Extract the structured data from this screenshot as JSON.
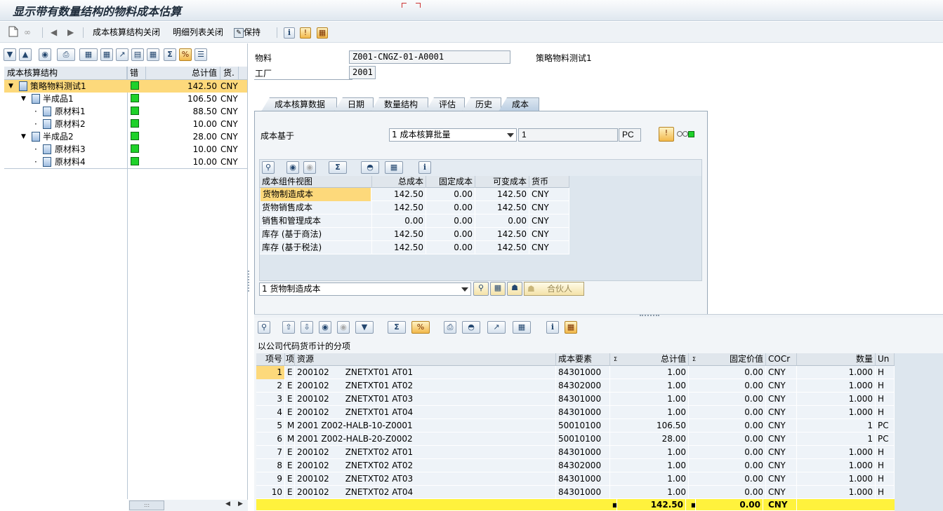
{
  "window": {
    "title": "显示带有数量结构的物料成本估算"
  },
  "toolbar": {
    "cost_structure_close": "成本核算结构关闭",
    "detail_list_close": "明细列表关闭",
    "keep": "保持"
  },
  "tree": {
    "headers": {
      "structure": "成本核算结构",
      "error": "错",
      "total": "总计值",
      "currency": "货."
    },
    "rows": [
      {
        "label": "策略物料测试1",
        "value": "142.50",
        "currency": "CNY"
      },
      {
        "label": "半成品1",
        "value": "106.50",
        "currency": "CNY"
      },
      {
        "label": "原材料1",
        "value": "88.50",
        "currency": "CNY"
      },
      {
        "label": "原材料2",
        "value": "10.00",
        "currency": "CNY"
      },
      {
        "label": "半成品2",
        "value": "28.00",
        "currency": "CNY"
      },
      {
        "label": "原材料3",
        "value": "10.00",
        "currency": "CNY"
      },
      {
        "label": "原材料4",
        "value": "10.00",
        "currency": "CNY"
      }
    ]
  },
  "header": {
    "material_label": "物料",
    "material_value": "Z001-CNGZ-01-A0001",
    "material_desc": "策略物料测试1",
    "plant_label": "工厂",
    "plant_value": "2001"
  },
  "tabs": [
    "成本核算数据",
    "日期",
    "数量结构",
    "评估",
    "历史",
    "成本"
  ],
  "cost": {
    "basis_label": "成本基于",
    "basis_value": "1 成本核算批量",
    "qty": "1",
    "unit": "PC",
    "view_headers": [
      "成本组件视图",
      "总成本",
      "固定成本",
      "可变成本",
      "货币"
    ],
    "view_rows": [
      [
        "货物制造成本",
        "142.50",
        "0.00",
        "142.50",
        "CNY"
      ],
      [
        "货物销售成本",
        "142.50",
        "0.00",
        "142.50",
        "CNY"
      ],
      [
        "销售和管理成本",
        "0.00",
        "0.00",
        "0.00",
        "CNY"
      ],
      [
        "库存 (基于商法)",
        "142.50",
        "0.00",
        "142.50",
        "CNY"
      ],
      [
        "库存 (基于税法)",
        "142.50",
        "0.00",
        "142.50",
        "CNY"
      ]
    ],
    "component_select": "1 货物制造成本",
    "partner_button": "合伙人"
  },
  "itemization": {
    "title": "以公司代码货币计的分项",
    "headers": [
      "项号",
      "项",
      "资源",
      "成本要素",
      "总计值",
      "固定价值",
      "COCr",
      "数量",
      "Un"
    ],
    "rows": [
      [
        "1",
        "E",
        "200102      ZNETXT01 AT01",
        "84301000",
        "1.00",
        "0.00",
        "CNY",
        "1.000",
        "H"
      ],
      [
        "2",
        "E",
        "200102      ZNETXT01 AT02",
        "84302000",
        "1.00",
        "0.00",
        "CNY",
        "1.000",
        "H"
      ],
      [
        "3",
        "E",
        "200102      ZNETXT01 AT03",
        "84301000",
        "1.00",
        "0.00",
        "CNY",
        "1.000",
        "H"
      ],
      [
        "4",
        "E",
        "200102      ZNETXT01 AT04",
        "84301000",
        "1.00",
        "0.00",
        "CNY",
        "1.000",
        "H"
      ],
      [
        "5",
        "M",
        "2001 Z002-HALB-10-Z0001",
        "50010100",
        "106.50",
        "0.00",
        "CNY",
        "1",
        "PC"
      ],
      [
        "6",
        "M",
        "2001 Z002-HALB-20-Z0002",
        "50010100",
        "28.00",
        "0.00",
        "CNY",
        "1",
        "PC"
      ],
      [
        "7",
        "E",
        "200102      ZNETXT02 AT01",
        "84301000",
        "1.00",
        "0.00",
        "CNY",
        "1.000",
        "H"
      ],
      [
        "8",
        "E",
        "200102      ZNETXT02 AT02",
        "84302000",
        "1.00",
        "0.00",
        "CNY",
        "1.000",
        "H"
      ],
      [
        "9",
        "E",
        "200102      ZNETXT02 AT03",
        "84301000",
        "1.00",
        "0.00",
        "CNY",
        "1.000",
        "H"
      ],
      [
        "10",
        "E",
        "200102      ZNETXT02 AT04",
        "84301000",
        "1.00",
        "0.00",
        "CNY",
        "1.000",
        "H"
      ]
    ],
    "sum_total": "142.50",
    "sum_fixed": "0.00",
    "sum_currency": "CNY"
  },
  "colors": {
    "selected_row": "#fdd97b",
    "status_green": "#1fd12a",
    "sum_row": "#fff23d"
  }
}
